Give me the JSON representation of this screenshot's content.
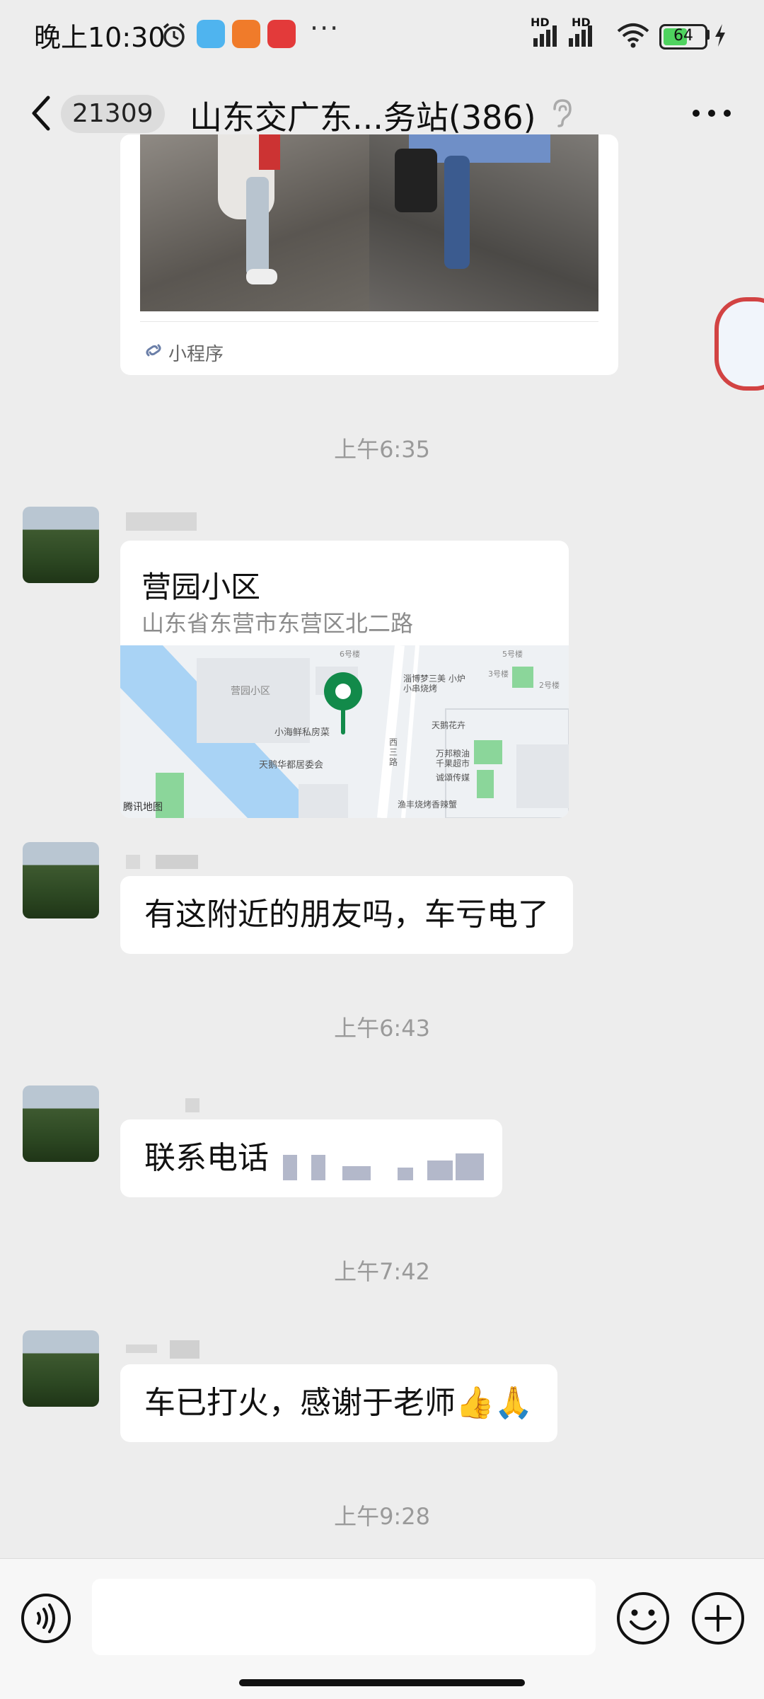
{
  "status_bar": {
    "time": "晚上10:30",
    "more": "···",
    "battery": "64",
    "battery_level": 0.64,
    "network_label": "HD"
  },
  "header": {
    "unread_count": "21309",
    "title": "山东交广东...务站(386)"
  },
  "messages": {
    "mini_program": {
      "label": "小程序"
    },
    "time_1": "上午6:35",
    "location": {
      "title": "营园小区",
      "address": "山东省东营市东营区北二路",
      "map_provider": "腾讯地图",
      "map_labels": [
        "营园小区",
        "小海鲜私房菜",
        "天鹅华都居委会",
        "淄博梦三美 小炉小串烧烤",
        "天鹅花卉",
        "万邦粮油 千果超市",
        "诚頌传媒",
        "渔丰烧烤香辣蟹",
        "西三路",
        "3号楼",
        "2号楼",
        "5号楼",
        "6号楼"
      ]
    },
    "text_1": "有这附近的朋友吗，车亏电了",
    "time_2": "上午6:43",
    "text_2": "联系电话",
    "time_3": "上午7:42",
    "text_3": "车已打火，感谢于老师👍🙏",
    "time_4": "上午9:28"
  },
  "input": {
    "placeholder": ""
  },
  "colors": {
    "background": "#ededed",
    "bubble": "#ffffff",
    "map_pin": "#128a4a",
    "water": "#a9d3f5"
  }
}
